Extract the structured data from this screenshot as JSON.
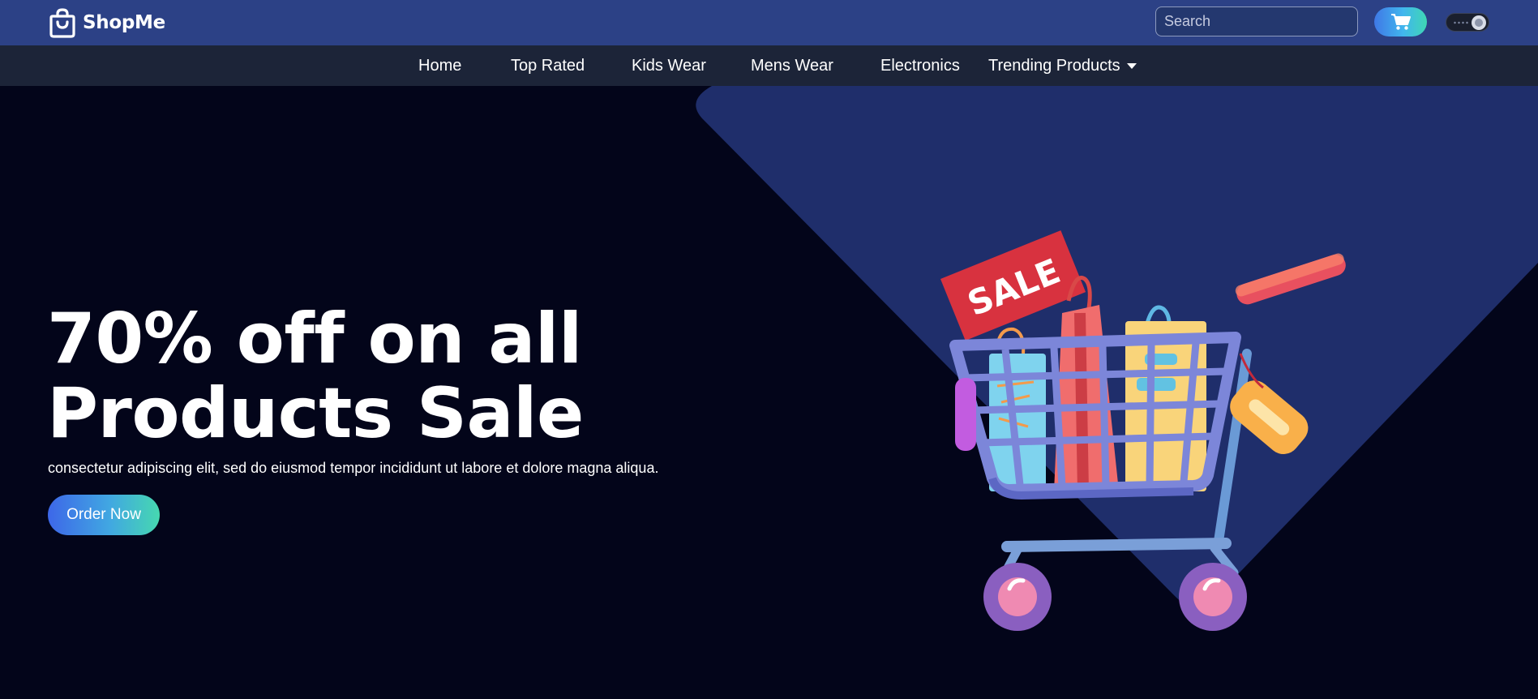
{
  "header": {
    "brand_name": "ShopMe",
    "brand_icon": "shopping-bag-icon",
    "search_placeholder": "Search",
    "cart_icon": "shopping-cart-icon",
    "theme_toggle": "dark-mode-toggle"
  },
  "nav": {
    "items": [
      {
        "label": "Home"
      },
      {
        "label": "Top Rated"
      },
      {
        "label": "Kids Wear"
      },
      {
        "label": "Mens Wear"
      },
      {
        "label": "Electronics"
      },
      {
        "label": "Trending Products",
        "has_dropdown": true
      }
    ]
  },
  "hero": {
    "title_line1": "70% off on all",
    "title_line2": "Products Sale",
    "subtitle": "consectetur adipiscing elit, sed do eiusmod tempor incididunt ut labore et dolore magna aliqua.",
    "cta_label": "Order Now",
    "sale_tag": "SALE",
    "illustration": "shopping-cart-with-bags-illustration"
  },
  "colors": {
    "header_bg": "#2c4186",
    "nav_bg": "#1c2438",
    "hero_bg": "#03051a",
    "hero_shape": "#1f2e6b",
    "accent_gradient_start": "#3d67e8",
    "accent_gradient_end": "#46d8b0",
    "sale_red": "#d8323f"
  }
}
